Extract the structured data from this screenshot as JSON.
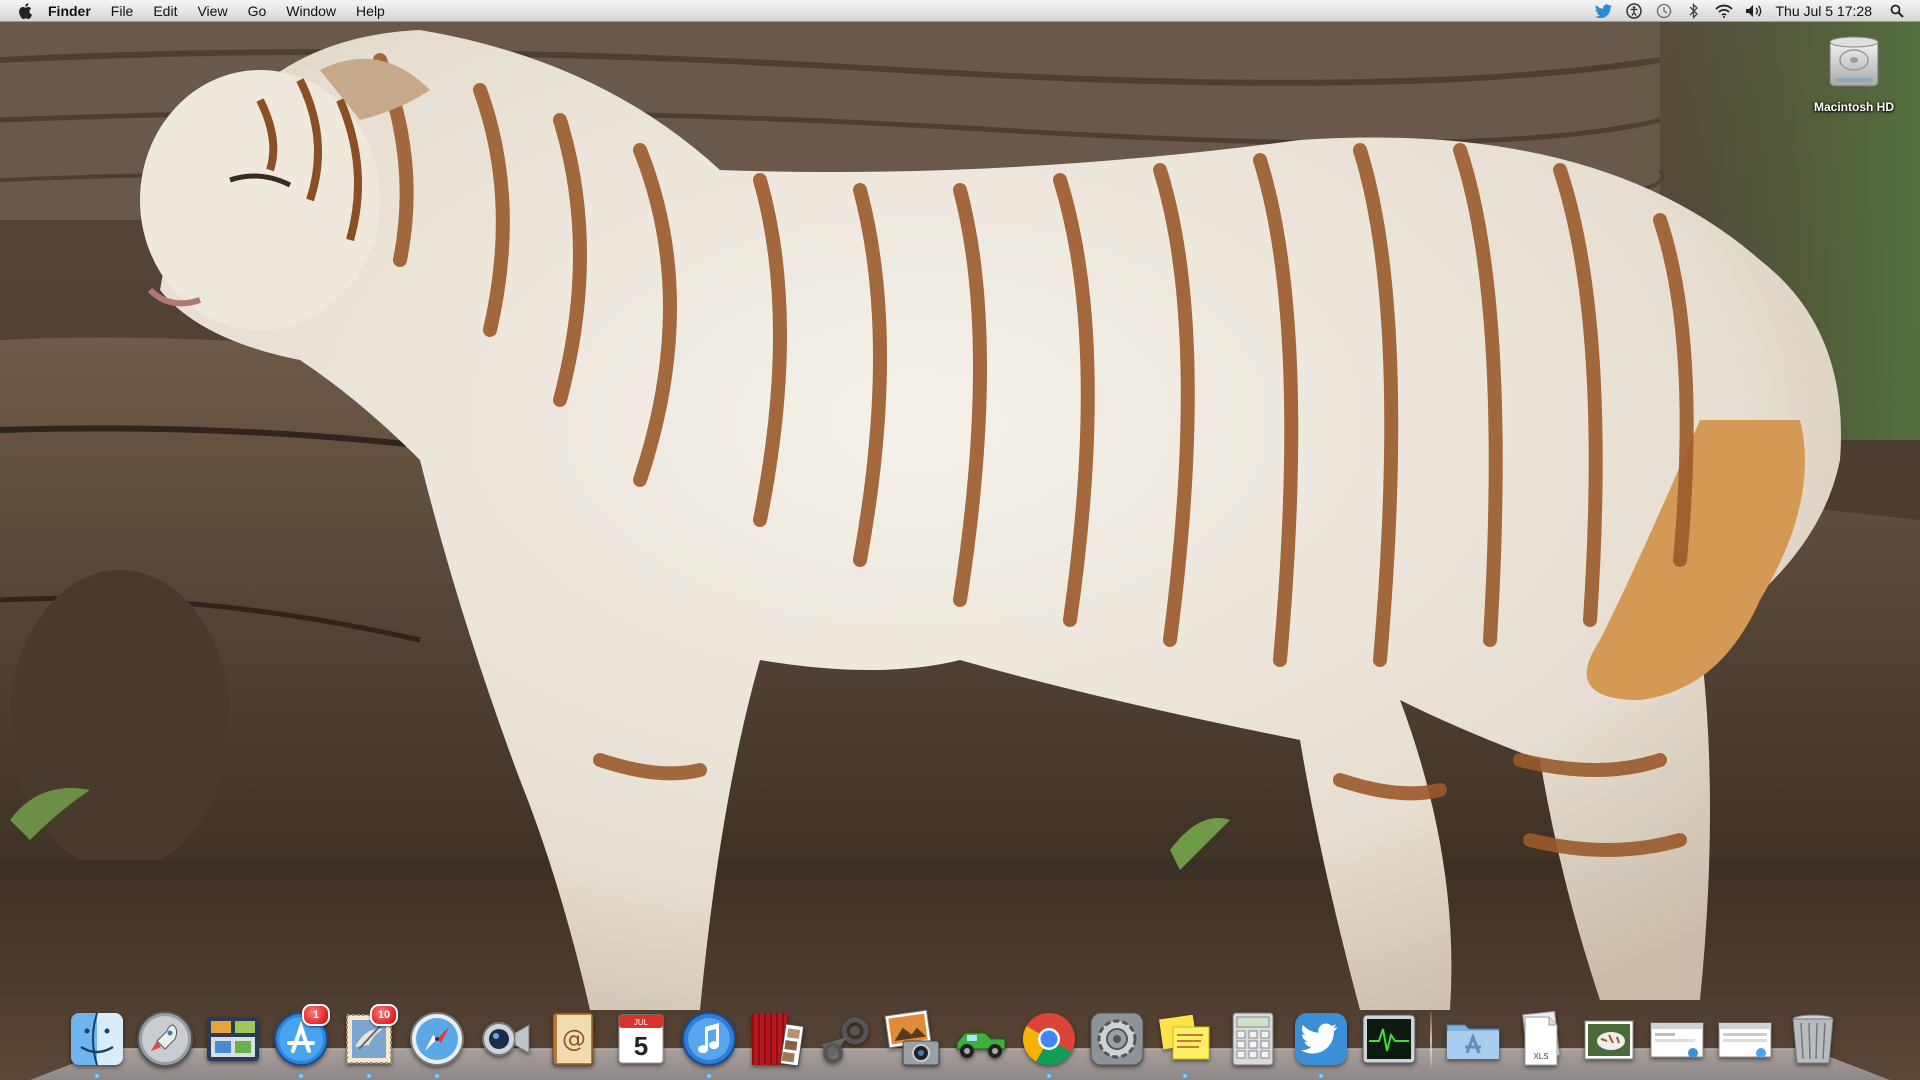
{
  "menubar": {
    "app_name": "Finder",
    "menus": [
      "File",
      "Edit",
      "View",
      "Go",
      "Window",
      "Help"
    ],
    "status_icons": [
      "twitter-icon",
      "accessibility-icon",
      "time-machine-icon",
      "bluetooth-icon",
      "wifi-icon",
      "volume-icon"
    ],
    "clock": "Thu Jul 5  17:28",
    "search_icon": "spotlight-icon"
  },
  "desktop": {
    "icons": [
      {
        "label": "Macintosh HD",
        "icon": "hard-drive-icon"
      }
    ]
  },
  "dock": {
    "apps": [
      {
        "name": "finder",
        "icon": "finder-icon",
        "running": true
      },
      {
        "name": "launchpad",
        "icon": "rocket-icon",
        "running": false
      },
      {
        "name": "mission-control",
        "icon": "mission-control-icon",
        "running": false
      },
      {
        "name": "app-store",
        "icon": "app-store-icon",
        "running": true,
        "badge": "1"
      },
      {
        "name": "mail",
        "icon": "mail-stamp-icon",
        "running": true,
        "badge": "10"
      },
      {
        "name": "safari",
        "icon": "compass-icon",
        "running": true
      },
      {
        "name": "facetime",
        "icon": "video-camera-icon",
        "running": false
      },
      {
        "name": "address-book",
        "icon": "address-book-icon",
        "running": false
      },
      {
        "name": "ical",
        "icon": "calendar-icon",
        "running": false,
        "calendar_month": "JUL",
        "calendar_day": "5"
      },
      {
        "name": "itunes",
        "icon": "music-note-icon",
        "running": true
      },
      {
        "name": "photo-booth",
        "icon": "photo-booth-icon",
        "running": false
      },
      {
        "name": "steam",
        "icon": "steam-icon",
        "running": false
      },
      {
        "name": "iphoto",
        "icon": "photo-camera-icon",
        "running": false
      },
      {
        "name": "game",
        "icon": "truck-icon",
        "running": false
      },
      {
        "name": "chrome",
        "icon": "chrome-icon",
        "running": true
      },
      {
        "name": "system-preferences",
        "icon": "gear-icon",
        "running": false
      },
      {
        "name": "stickies",
        "icon": "sticky-notes-icon",
        "running": true
      },
      {
        "name": "calculator",
        "icon": "calculator-icon",
        "running": false
      },
      {
        "name": "twitter",
        "icon": "twitter-bird-icon",
        "running": true
      },
      {
        "name": "activity-monitor",
        "icon": "activity-monitor-icon",
        "running": false
      }
    ],
    "stacks": [
      {
        "name": "applications-folder",
        "icon": "folder-icon"
      },
      {
        "name": "document-stack",
        "icon": "document-icon",
        "label": "XLS"
      },
      {
        "name": "downloads-stack",
        "icon": "image-stack-icon"
      },
      {
        "name": "window-minimized-1",
        "icon": "window-thumbnail-icon"
      },
      {
        "name": "window-minimized-2",
        "icon": "window-thumbnail-icon"
      },
      {
        "name": "trash",
        "icon": "trash-icon"
      }
    ]
  },
  "colors": {
    "menubar_top": "#f5f5f5",
    "menubar_bottom": "#d6d6d6",
    "badge": "#d40000",
    "running_indicator": "#4aa4e6"
  }
}
